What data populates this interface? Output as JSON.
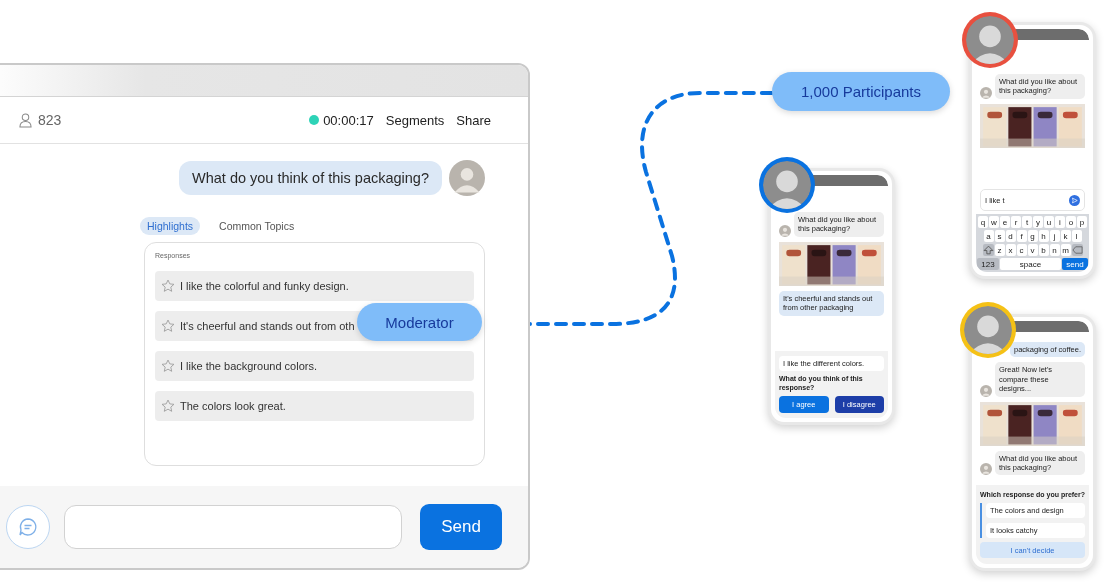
{
  "moderator_window": {
    "participant_count": "823",
    "timer": "00:00:17",
    "nav": [
      "Segments",
      "Share"
    ],
    "question": "What do you think of this packaging?",
    "tabs": [
      {
        "label": "Highlights",
        "selected": true
      },
      {
        "label": "Common Topics",
        "selected": false
      }
    ],
    "responses_label": "Responses",
    "responses": [
      {
        "text": "I like the colorful and funky design.",
        "starred": false
      },
      {
        "text": "It's cheerful and stands out from oth",
        "starred": false
      },
      {
        "text": "I like the  background colors.",
        "starred": false
      },
      {
        "text": "The colors look great.",
        "starred": false
      }
    ],
    "send_button": "Send"
  },
  "labels": [
    {
      "text": "Moderator"
    },
    {
      "text": "1,000 Participants"
    }
  ],
  "phones": [
    {
      "kind": "vote",
      "color": "#0a72e0",
      "messages": [
        {
          "kind": "moderator",
          "text": "What did you like about this packaging?"
        },
        {
          "kind": "picture"
        },
        {
          "kind": "participant",
          "text": "It's cheerful and stands out from other packaging"
        }
      ],
      "response": "I like the different colors.",
      "prompt": "What do you think of this response?",
      "buttons": [
        {
          "label": "I agree",
          "kind": "primary"
        },
        {
          "label": "I disagree",
          "kind": "dark"
        }
      ]
    },
    {
      "kind": "typing",
      "color": "#e8503f",
      "messages": [
        {
          "kind": "moderator",
          "text": "What did you like about this packaging?"
        },
        {
          "kind": "picture"
        }
      ],
      "input": "I like t",
      "keyboard": {
        "rows": [
          [
            "q",
            "w",
            "e",
            "r",
            "t",
            "y",
            "u",
            "i",
            "o",
            "p"
          ],
          [
            "a",
            "s",
            "d",
            "f",
            "g",
            "h",
            "j",
            "k",
            "l"
          ],
          [
            "z",
            "x",
            "c",
            "v",
            "b",
            "n",
            "m"
          ]
        ],
        "numbers_key": "123",
        "space_key": "space",
        "action_key": "send"
      }
    },
    {
      "kind": "preference",
      "color": "#f5c116",
      "messages": [
        {
          "kind": "participant",
          "text": "packaging of coffee."
        },
        {
          "kind": "moderator",
          "text": "Great! Now let's compare these designs..."
        },
        {
          "kind": "picture"
        },
        {
          "kind": "moderator",
          "text": "What did you like about this packaging?"
        }
      ],
      "prompt": "Which response do you prefer?",
      "options": [
        "The colors and design",
        "It looks catchy"
      ],
      "undecided_button": "I can't decide"
    }
  ]
}
